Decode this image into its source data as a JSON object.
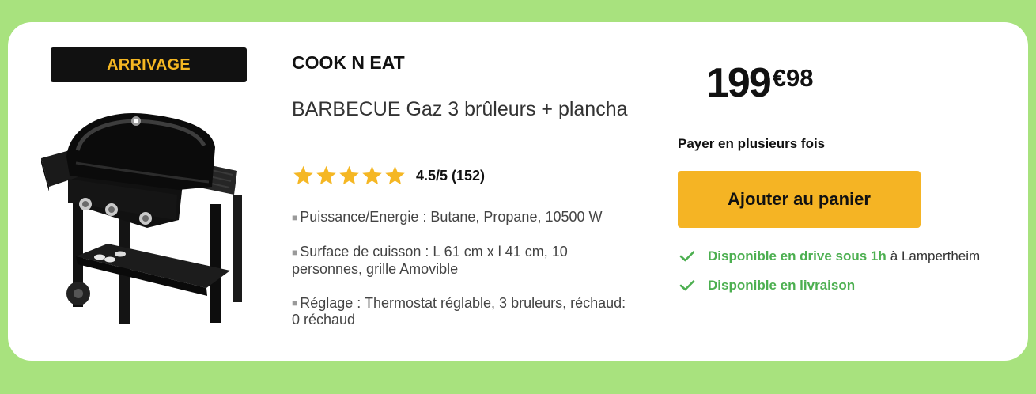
{
  "badge": {
    "label": "ARRIVAGE"
  },
  "product": {
    "brand": "COOK N EAT",
    "title": "BARBECUE Gaz 3 brûleurs + plancha",
    "rating": {
      "stars": 5,
      "text": "4.5/5 (152)"
    },
    "features": [
      "Puissance/Energie : Butane, Propane, 10500 W",
      "Surface de cuisson : L 61 cm x l 41 cm, 10 personnes, grille Amovible",
      "Réglage : Thermostat réglable, 3 bruleurs, réchaud: 0 réchaud"
    ],
    "bullet": "■"
  },
  "price": {
    "integer": "199",
    "decimal": "€98"
  },
  "installments": "Payer en plusieurs fois",
  "cart": {
    "button_label": "Ajouter au panier"
  },
  "availability": [
    {
      "strong": "Disponible en drive sous 1h",
      "location": "à Lampertheim"
    },
    {
      "strong": "Disponible en livraison",
      "location": ""
    }
  ],
  "colors": {
    "background": "#a8e27e",
    "badge_bg": "#111111",
    "badge_text": "#f5b722",
    "star": "#f5b724",
    "button": "#f5b424",
    "available": "#4caf50"
  },
  "icons": {
    "star": "star-icon",
    "check": "check-icon"
  }
}
